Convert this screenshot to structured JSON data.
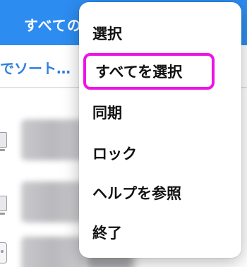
{
  "header": {
    "title": "すべての"
  },
  "sort_row": {
    "label": "でソート…"
  },
  "list": {
    "rows": [
      {
        "icon": "computer-icon"
      },
      {
        "icon": "computer-icon"
      },
      {
        "icon": "phone-icon"
      }
    ]
  },
  "context_menu": {
    "items": [
      {
        "label": "選択"
      },
      {
        "label": "すべてを選択",
        "highlighted": true
      },
      {
        "label": "同期"
      },
      {
        "label": "ロック"
      },
      {
        "label": "ヘルプを参照"
      },
      {
        "label": "終了"
      }
    ]
  },
  "colors": {
    "header_bg": "#2d8cf0",
    "sort_text": "#2d7fe0",
    "highlight_border": "#ee14e6"
  }
}
